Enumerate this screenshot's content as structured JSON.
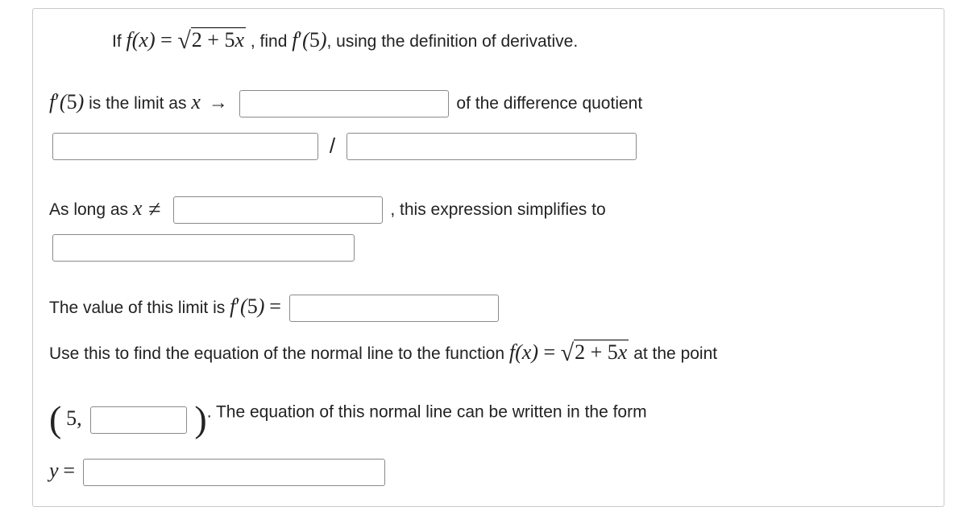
{
  "line1": {
    "if": "If ",
    "f": "f",
    "x": "x",
    "eq": " = ",
    "two": "2",
    "plus": " + ",
    "five": "5",
    "x2": "x",
    "find": ", find ",
    "fp": "f",
    "five_arg": "5",
    "after": ", using the definition of derivative."
  },
  "line2": {
    "fp": "f",
    "five_arg": "5",
    "is_limit": " is the limit as ",
    "x": "x",
    "arrow": " →",
    "of_diff_q": " of the difference quotient",
    "slash": "/"
  },
  "line3": {
    "as_long": "As long as ",
    "x": "x",
    "comma": ", ",
    "simplifies": "this expression simplifies to"
  },
  "line4": {
    "value_is": "The value of this limit is ",
    "fp": "f",
    "five_arg": "5",
    "eq": " =",
    "use_this": "Use this to find the equation of the normal line to the function ",
    "f": "f",
    "x": "x",
    "eq2": " = ",
    "two": "2",
    "plus": " + ",
    "five": "5",
    "x2": "x",
    "at_point": " at the point",
    "five_pt": "5",
    "comma": ",",
    "period": ". ",
    "norm_line": "The equation of this normal line can be written in the form",
    "y": "y",
    "eq3": " ="
  }
}
